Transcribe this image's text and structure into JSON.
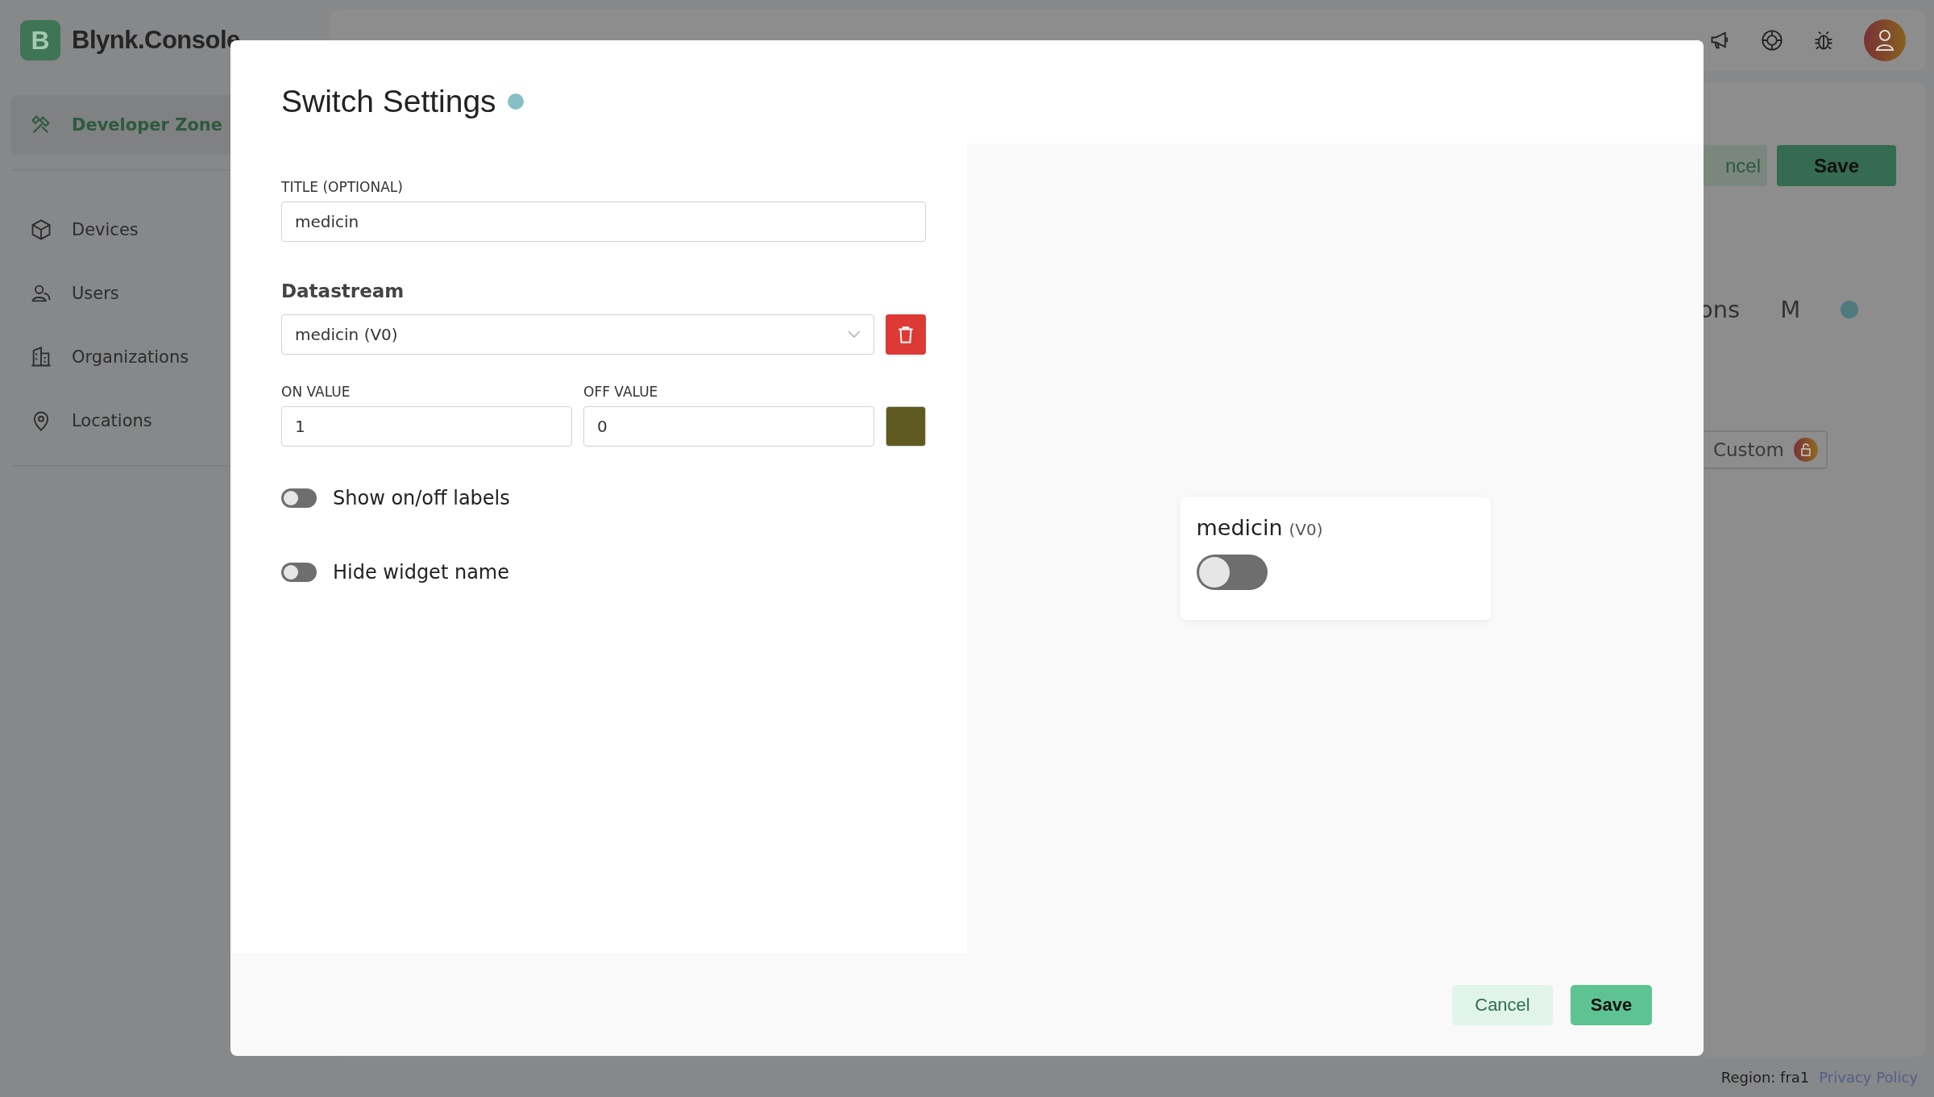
{
  "sidebar": {
    "logo_letter": "B",
    "logo_text": "Blynk.Console",
    "items": [
      {
        "label": "Developer Zone",
        "selected": true
      },
      {
        "label": "Devices",
        "selected": false
      },
      {
        "label": "Users",
        "selected": false
      },
      {
        "label": "Organizations",
        "selected": false
      },
      {
        "label": "Locations",
        "selected": false
      }
    ]
  },
  "background": {
    "cancel_button": "ncel",
    "save_button": "Save",
    "tabs": [
      "ons",
      "M"
    ],
    "template_option": "Custom"
  },
  "footer": {
    "region": "Region: fra1",
    "link": "Privacy Policy"
  },
  "dialog": {
    "title": "Switch Settings",
    "title_field": {
      "label": "TITLE (OPTIONAL)",
      "value": "medicin"
    },
    "datastream": {
      "label": "Datastream",
      "value": "medicin (V0)"
    },
    "on_value": {
      "label": "ON VALUE",
      "value": "1"
    },
    "off_value": {
      "label": "OFF VALUE",
      "value": "0"
    },
    "color": "#5f5a1f",
    "toggles": [
      {
        "label": "Show on/off labels",
        "on": false
      },
      {
        "label": "Hide widget name",
        "on": false
      }
    ],
    "preview": {
      "name": "medicin",
      "pin": "(V0)",
      "on": false
    },
    "buttons": {
      "cancel": "Cancel",
      "save": "Save"
    }
  }
}
